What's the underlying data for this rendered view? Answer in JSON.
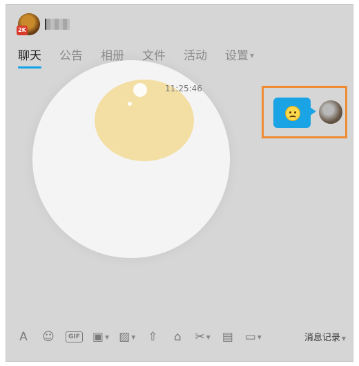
{
  "header": {
    "avatar_badge": "2K",
    "tabs": [
      {
        "label": "聊天",
        "active": true
      },
      {
        "label": "公告"
      },
      {
        "label": "相册"
      },
      {
        "label": "文件"
      },
      {
        "label": "活动"
      },
      {
        "label": "设置",
        "dropdown": true
      }
    ]
  },
  "chat": {
    "timestamp": "11:25:46",
    "message": {
      "type": "emoji",
      "icon": "embarrassed-face-emoji"
    }
  },
  "toolbar": {
    "tools": [
      "font-icon",
      "emoji-icon",
      "gif-icon",
      "sticker-icon",
      "image-icon",
      "upload-icon",
      "gift-icon",
      "screenshot-icon",
      "document-icon",
      "chat-bubble-icon"
    ],
    "gif_label": "GIF",
    "history_label": "消息记录"
  },
  "colors": {
    "accent": "#12a4e8",
    "highlight_border": "#f08a33",
    "bubble": "#1aa4e6"
  }
}
